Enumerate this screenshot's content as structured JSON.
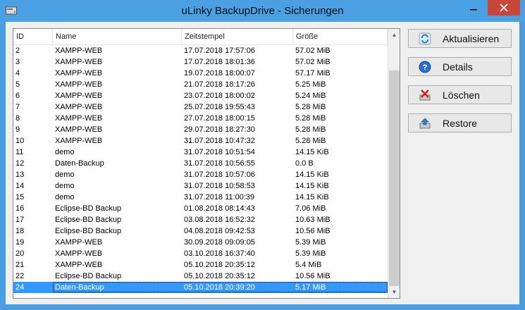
{
  "window": {
    "title": "uLinky BackupDrive - Sicherungen"
  },
  "columns": [
    "ID",
    "Name",
    "Zeitstempel",
    "Größe"
  ],
  "rows": [
    {
      "id": "2",
      "name": "XAMPP-WEB",
      "ts": "17.07.2018 17:57:06",
      "size": "57.02 MiB"
    },
    {
      "id": "3",
      "name": "XAMPP-WEB",
      "ts": "17.07.2018 18:01:36",
      "size": "57.02 MiB"
    },
    {
      "id": "4",
      "name": "XAMPP-WEB",
      "ts": "19.07.2018 18:00:07",
      "size": "57.17 MiB"
    },
    {
      "id": "5",
      "name": "XAMPP-WEB",
      "ts": "21.07.2018 18:17:26",
      "size": "5.25 MiB"
    },
    {
      "id": "6",
      "name": "XAMPP-WEB",
      "ts": "23.07.2018 18:00:02",
      "size": "5.24 MiB"
    },
    {
      "id": "7",
      "name": "XAMPP-WEB",
      "ts": "25.07.2018 19:55:43",
      "size": "5.28 MiB"
    },
    {
      "id": "8",
      "name": "XAMPP-WEB",
      "ts": "27.07.2018 18:00:15",
      "size": "5.28 MiB"
    },
    {
      "id": "9",
      "name": "XAMPP-WEB",
      "ts": "29.07.2018 18:27:30",
      "size": "5.28 MiB"
    },
    {
      "id": "10",
      "name": "XAMPP-WEB",
      "ts": "31.07.2018 10:47:32",
      "size": "5.28 MiB"
    },
    {
      "id": "11",
      "name": "demo",
      "ts": "31.07.2018 10:51:54",
      "size": "14.15 KiB"
    },
    {
      "id": "12",
      "name": "Daten-Backup",
      "ts": "31.07.2018 10:56:55",
      "size": "0.0 B"
    },
    {
      "id": "13",
      "name": "demo",
      "ts": "31.07.2018 10:57:06",
      "size": "14.15 KiB"
    },
    {
      "id": "14",
      "name": "demo",
      "ts": "31.07.2018 10:58:53",
      "size": "14.15 KiB"
    },
    {
      "id": "15",
      "name": "demo",
      "ts": "31.07.2018 11:00:39",
      "size": "14.15 KiB"
    },
    {
      "id": "16",
      "name": "Eclipse-BD Backup",
      "ts": "01.08.2018 08:14:43",
      "size": "7.06 MiB"
    },
    {
      "id": "17",
      "name": "Eclipse-BD Backup",
      "ts": "03.08.2018 16:52:32",
      "size": "10.63 MiB"
    },
    {
      "id": "18",
      "name": "Eclipse-BD Backup",
      "ts": "04.08.2018 09:42:53",
      "size": "10.56 MiB"
    },
    {
      "id": "19",
      "name": "XAMPP-WEB",
      "ts": "30.09.2018 09:09:05",
      "size": "5.39 MiB"
    },
    {
      "id": "20",
      "name": "XAMPP-WEB",
      "ts": "03.10.2018 16:37:40",
      "size": "5.39 MiB"
    },
    {
      "id": "21",
      "name": "XAMPP-WEB",
      "ts": "05.10.2018 20:35:12",
      "size": "5.4 MiB"
    },
    {
      "id": "22",
      "name": "Eclipse-BD Backup",
      "ts": "05.10.2018 20:35:12",
      "size": "10.56 MiB"
    },
    {
      "id": "24",
      "name": "Daten-Backup",
      "ts": "05.10.2018 20:39:20",
      "size": "5.17 MiB",
      "selected": true
    }
  ],
  "buttons": {
    "refresh": "Aktualisieren",
    "details": "Details",
    "delete": "Löschen",
    "restore": "Restore"
  },
  "colors": {
    "selection": "#3399ff",
    "titlebar": "#4aa0e2",
    "close": "#c7463a"
  }
}
